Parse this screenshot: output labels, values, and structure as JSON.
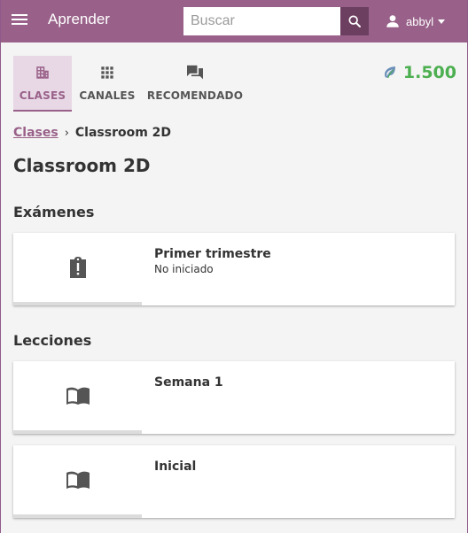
{
  "app": {
    "title": "Aprender",
    "search_placeholder": "Buscar",
    "search_value": "",
    "user_name": "abbyl",
    "accent_color": "#996189"
  },
  "tabs": [
    {
      "label": "CLASES",
      "icon": "classes-icon",
      "active": true
    },
    {
      "label": "CANALES",
      "icon": "channels-grid-icon",
      "active": false
    },
    {
      "label": "RECOMENDADO",
      "icon": "recommended-forum-icon",
      "active": false
    }
  ],
  "points": {
    "value": "1.500",
    "icon": "points-leaf-icon",
    "color": "#4caf50"
  },
  "breadcrumb": {
    "link": "Clases",
    "separator": "›",
    "current": "Classroom 2D"
  },
  "page_title": "Classroom 2D",
  "exams": {
    "heading": "Exámenes",
    "items": [
      {
        "title": "Primer trimestre",
        "status": "No iniciado",
        "icon": "exam-clipboard-icon",
        "progress": 0
      }
    ]
  },
  "lessons": {
    "heading": "Lecciones",
    "items": [
      {
        "title": "Semana 1",
        "icon": "lesson-book-icon",
        "progress": 0
      },
      {
        "title": "Inicial",
        "icon": "lesson-book-icon",
        "progress": 0
      }
    ]
  }
}
